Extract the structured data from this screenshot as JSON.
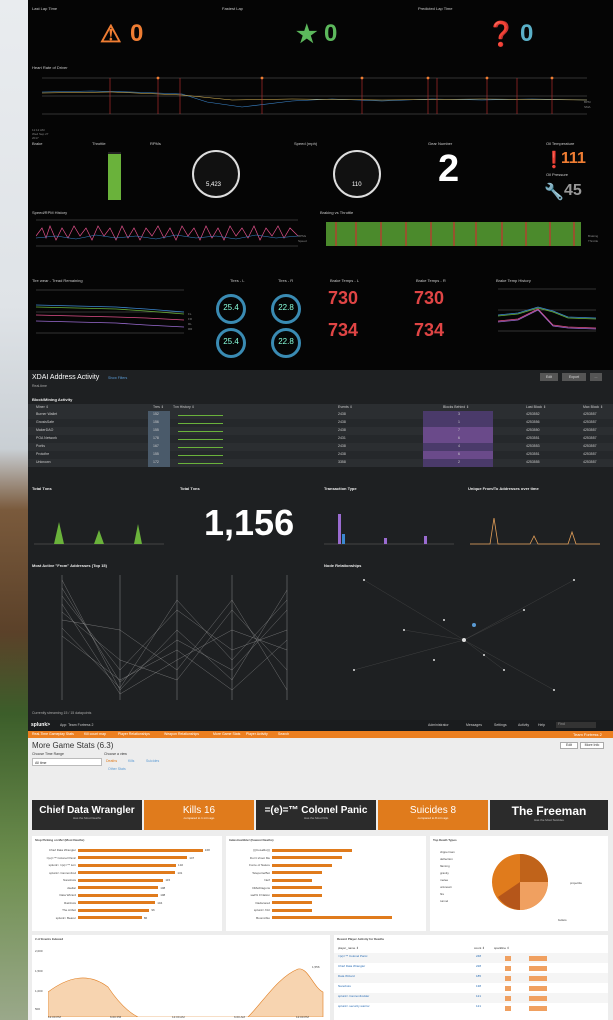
{
  "racing": {
    "last_lap_label": "Last Lap Time",
    "fastest_lap_label": "Fastest Lap",
    "predicted_lap_label": "Predicted Lap Time",
    "last_lap_value": "0",
    "fastest_lap_value": "0",
    "predicted_lap_value": "0",
    "heart_rate_title": "Heart Rate of Driver",
    "hr_legend": [
      "BPM",
      "SMA"
    ],
    "brake": "Brake",
    "throttle": "Throttle",
    "rpms": "RPMs",
    "speed": "Speed (mph)",
    "gear": "Gear Number",
    "gear_value": "2",
    "rpm_value": "5,423",
    "speed_value": "110",
    "oil_temp_label": "Oil Temperature",
    "oil_temp_value": "111",
    "oil_pressure_label": "Oil Pressure",
    "oil_pressure_value": "45",
    "speed_rpm_history": "Speed/RPM History",
    "braking_throttle": "Braking vs Throttle",
    "tire_wear": "Tire wear - Tread Remaining",
    "tires_l": "Tires - L",
    "tires_r": "Tires - R",
    "tire_vals": [
      "25.4",
      "22.8",
      "25.4",
      "22.8"
    ],
    "brake_temps_l": "Brake Temps - L",
    "brake_temps_r": "Brake Temps - R",
    "brake_temp_history": "Brake Temp History",
    "brake_vals": [
      "730",
      "730",
      "734",
      "734"
    ],
    "time_ticks": [
      "11:12 AM\nWed Sep 27\n2017",
      "11:13 AM",
      "11:14 AM",
      "11:15 AM",
      "11:16 AM",
      "11:17 AM",
      "11:18 AM",
      "11:19 AM",
      "11:20 AM",
      "11:21 AM",
      "11:22 AM",
      "11:23 AM",
      "11:24 AM",
      "11:25 AM",
      "11:26 AM"
    ],
    "legend_sr": [
      "RPMs",
      "Speed"
    ],
    "legend_bt": [
      "Braking",
      "Throttle"
    ],
    "legend_tire": [
      "FL",
      "FR",
      "RL",
      "RR"
    ]
  },
  "xdai": {
    "title": "XDAI Address Activity",
    "edit": "Edit",
    "export": "Export",
    "more": "...",
    "subtitle": "Real-time",
    "filters": "Show Filters",
    "block_panel": "Block/Mining Activity",
    "cols": [
      "Miner ⇕",
      "Tres ⇕",
      "Txn History ⇕",
      "Events ⇕",
      "Blocks Behind ⇕",
      "Last Block ⇕",
      "Max Block ⇕"
    ],
    "rows": [
      [
        "Burner Wallet",
        "152",
        "2438",
        "3",
        "4253552",
        "4253557"
      ],
      [
        "GnosisSafe",
        "156",
        "2438",
        "1",
        "4253556",
        "4253557"
      ],
      [
        "MakerDAO",
        "155",
        "2438",
        "7",
        "4253550",
        "4253557"
      ],
      [
        "POA Network",
        "178",
        "2431",
        "6",
        "4253551",
        "4253557"
      ],
      [
        "Portis",
        "167",
        "2438",
        "4",
        "4253553",
        "4253557"
      ],
      [
        "Protofire",
        "155",
        "2438",
        "6",
        "4253551",
        "4253557"
      ],
      [
        "Unknown",
        "172",
        "3358",
        "2",
        "4253555",
        "4253557"
      ]
    ],
    "total_txns": "Total Txns",
    "total_txns2": "Total Txns",
    "big_value": "1,156",
    "txn_type": "Transaction Type",
    "unique": "Unique From/To Addresses over time",
    "most_active": "Most Active \"From\" Addresses (Top 15)",
    "node_rel": "Node Relationships",
    "streaming": "Currently streaming 15 / 15 datapoints"
  },
  "game": {
    "app": "App: Team Fortress 2",
    "nav": [
      "Administrator",
      "Messages",
      "Settings",
      "Activity",
      "Help",
      "Find"
    ],
    "tabs": [
      "Real-Time Gameplay Stats",
      "Kill count map",
      "Player Relationships",
      "Weapon Relationships",
      "More Game Stats",
      "Player Activity",
      "Search"
    ],
    "brand": "Team Fortress 2",
    "title": "More Game Stats (6.3)",
    "time_label": "Choose Time Range",
    "time_value": "All time",
    "view_label": "Choose a view",
    "views": [
      "Deaths",
      "Kills",
      "Suicides",
      "Other Stats"
    ],
    "edit": "Edit",
    "more_info": "More Info",
    "cards": [
      {
        "big": "Chief Data Wrangler",
        "small": "Has the Most Deaths"
      },
      {
        "big": "Kills 16",
        "small": "compared to 1 min ago"
      },
      {
        "big": "=(e)=™ Colonel Panic",
        "small": "Has the Most Kills"
      },
      {
        "big": "Suicides 8",
        "small": "compared to 8 min ago"
      },
      {
        "big": "The Freeman",
        "small": "Has the Most Suicides"
      }
    ],
    "deaths_title": "Stop Picking on Me! (Most Deaths)",
    "deaths": [
      [
        "Chief Data Wrangler",
        168
      ],
      [
        "=(e)=™ Colonel Panic",
        147
      ],
      [
        "splunk> =(e)=™ turn",
        132
      ],
      [
        "splunk> CannonFod",
        131
      ],
      [
        "Nanobots",
        115
      ],
      [
        "dsellar",
        108
      ],
      [
        "Data Wizard",
        108
      ],
      [
        "Rainbots",
        104
      ],
      [
        "The Artbot",
        96
      ],
      [
        "splunk> Bearer",
        86
      ]
    ],
    "indestructible": "Indestructible! (Fewest Deaths)",
    "fewest": [
      [
        "(((CoLaRo)))",
        8
      ],
      [
        "Don't shoot Me",
        7
      ],
      [
        "Force of Nature",
        6
      ],
      [
        "TeleporterBot",
        5
      ],
      [
        "Nerf",
        4
      ],
      [
        "DMeDragons",
        5
      ],
      [
        "sad% 0 Nation",
        5
      ],
      [
        "Dadscared",
        4
      ],
      [
        "splunk> fritz",
        4
      ],
      [
        "BoomsSto",
        12
      ]
    ],
    "death_types": "Top Death Types",
    "death_labels": [
      "clipperman",
      "deflection",
      "flaming",
      "gravity",
      "melee",
      "unknown",
      "fire",
      "tunnel",
      "bullets",
      "projectile"
    ],
    "events_title": "# of Events Indexed",
    "events_y": [
      "2,000",
      "1,500",
      "1,000",
      "500"
    ],
    "events_peak": "1,556",
    "events_x": [
      "12:00 PM",
      "6:00 PM",
      "12:00 AM",
      "6:00 AM",
      "12:00 PM"
    ],
    "recent": "Recent Player Activity for Deaths",
    "recent_cols": [
      "player_name ⇕",
      "count ⇕",
      "sparkline ⇕"
    ],
    "recent_rows": [
      [
        "=(e)=™ Colonel Panic",
        "248"
      ],
      [
        "Chief Data Wrangler",
        "228"
      ],
      [
        "Data Wizard",
        "185"
      ],
      [
        "Nanobots",
        "138"
      ],
      [
        "splunk> CannonFodder",
        "121"
      ],
      [
        "splunk> security warrior",
        "121"
      ]
    ]
  }
}
